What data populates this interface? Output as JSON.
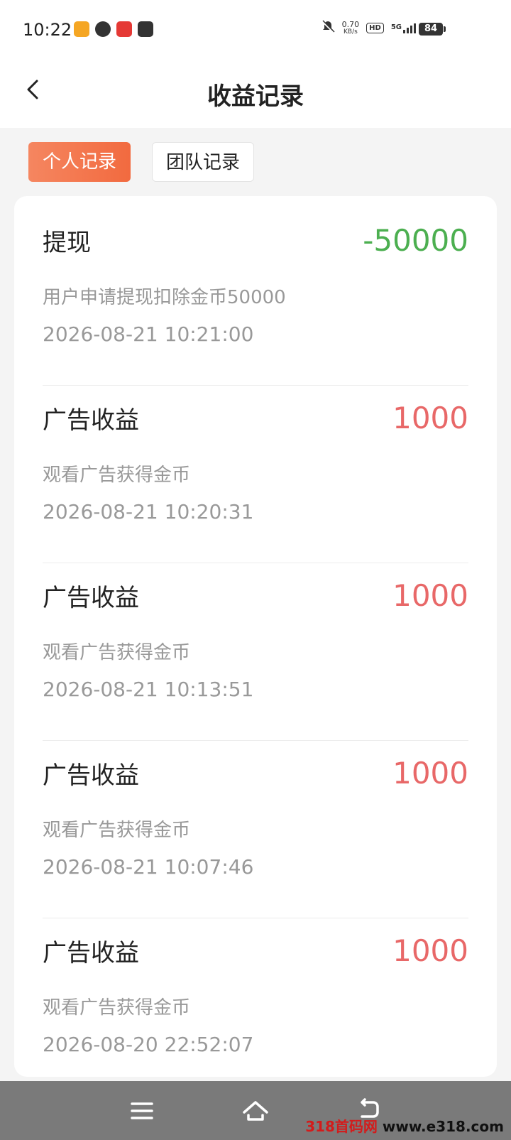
{
  "status_bar": {
    "time": "10:22",
    "net_speed_value": "0.70",
    "net_speed_unit": "KB/s",
    "hd_label": "HD",
    "signal_label": "5G",
    "battery": "84",
    "app_icon_colors": [
      "#f5a623",
      "#333333",
      "#e53935",
      "#333333"
    ]
  },
  "header": {
    "title": "收益记录"
  },
  "tabs": [
    {
      "label": "个人记录",
      "active": true
    },
    {
      "label": "团队记录",
      "active": false
    }
  ],
  "records": [
    {
      "title": "提现",
      "amount": "-50000",
      "description": "用户申请提现扣除金币50000",
      "time": "2026-08-21 10:21:00"
    },
    {
      "title": "广告收益",
      "amount": "1000",
      "description": "观看广告获得金币",
      "time": "2026-08-21 10:20:31"
    },
    {
      "title": "广告收益",
      "amount": "1000",
      "description": "观看广告获得金币",
      "time": "2026-08-21 10:13:51"
    },
    {
      "title": "广告收益",
      "amount": "1000",
      "description": "观看广告获得金币",
      "time": "2026-08-21 10:07:46"
    },
    {
      "title": "广告收益",
      "amount": "1000",
      "description": "观看广告获得金币",
      "time": "2026-08-20 22:52:07"
    }
  ],
  "colors": {
    "accent": "#f26a3f",
    "negative_amount": "#4caf50",
    "positive_amount": "#e86868"
  },
  "watermark": {
    "prefix": "318首码网",
    "url": " www.e318.com"
  }
}
